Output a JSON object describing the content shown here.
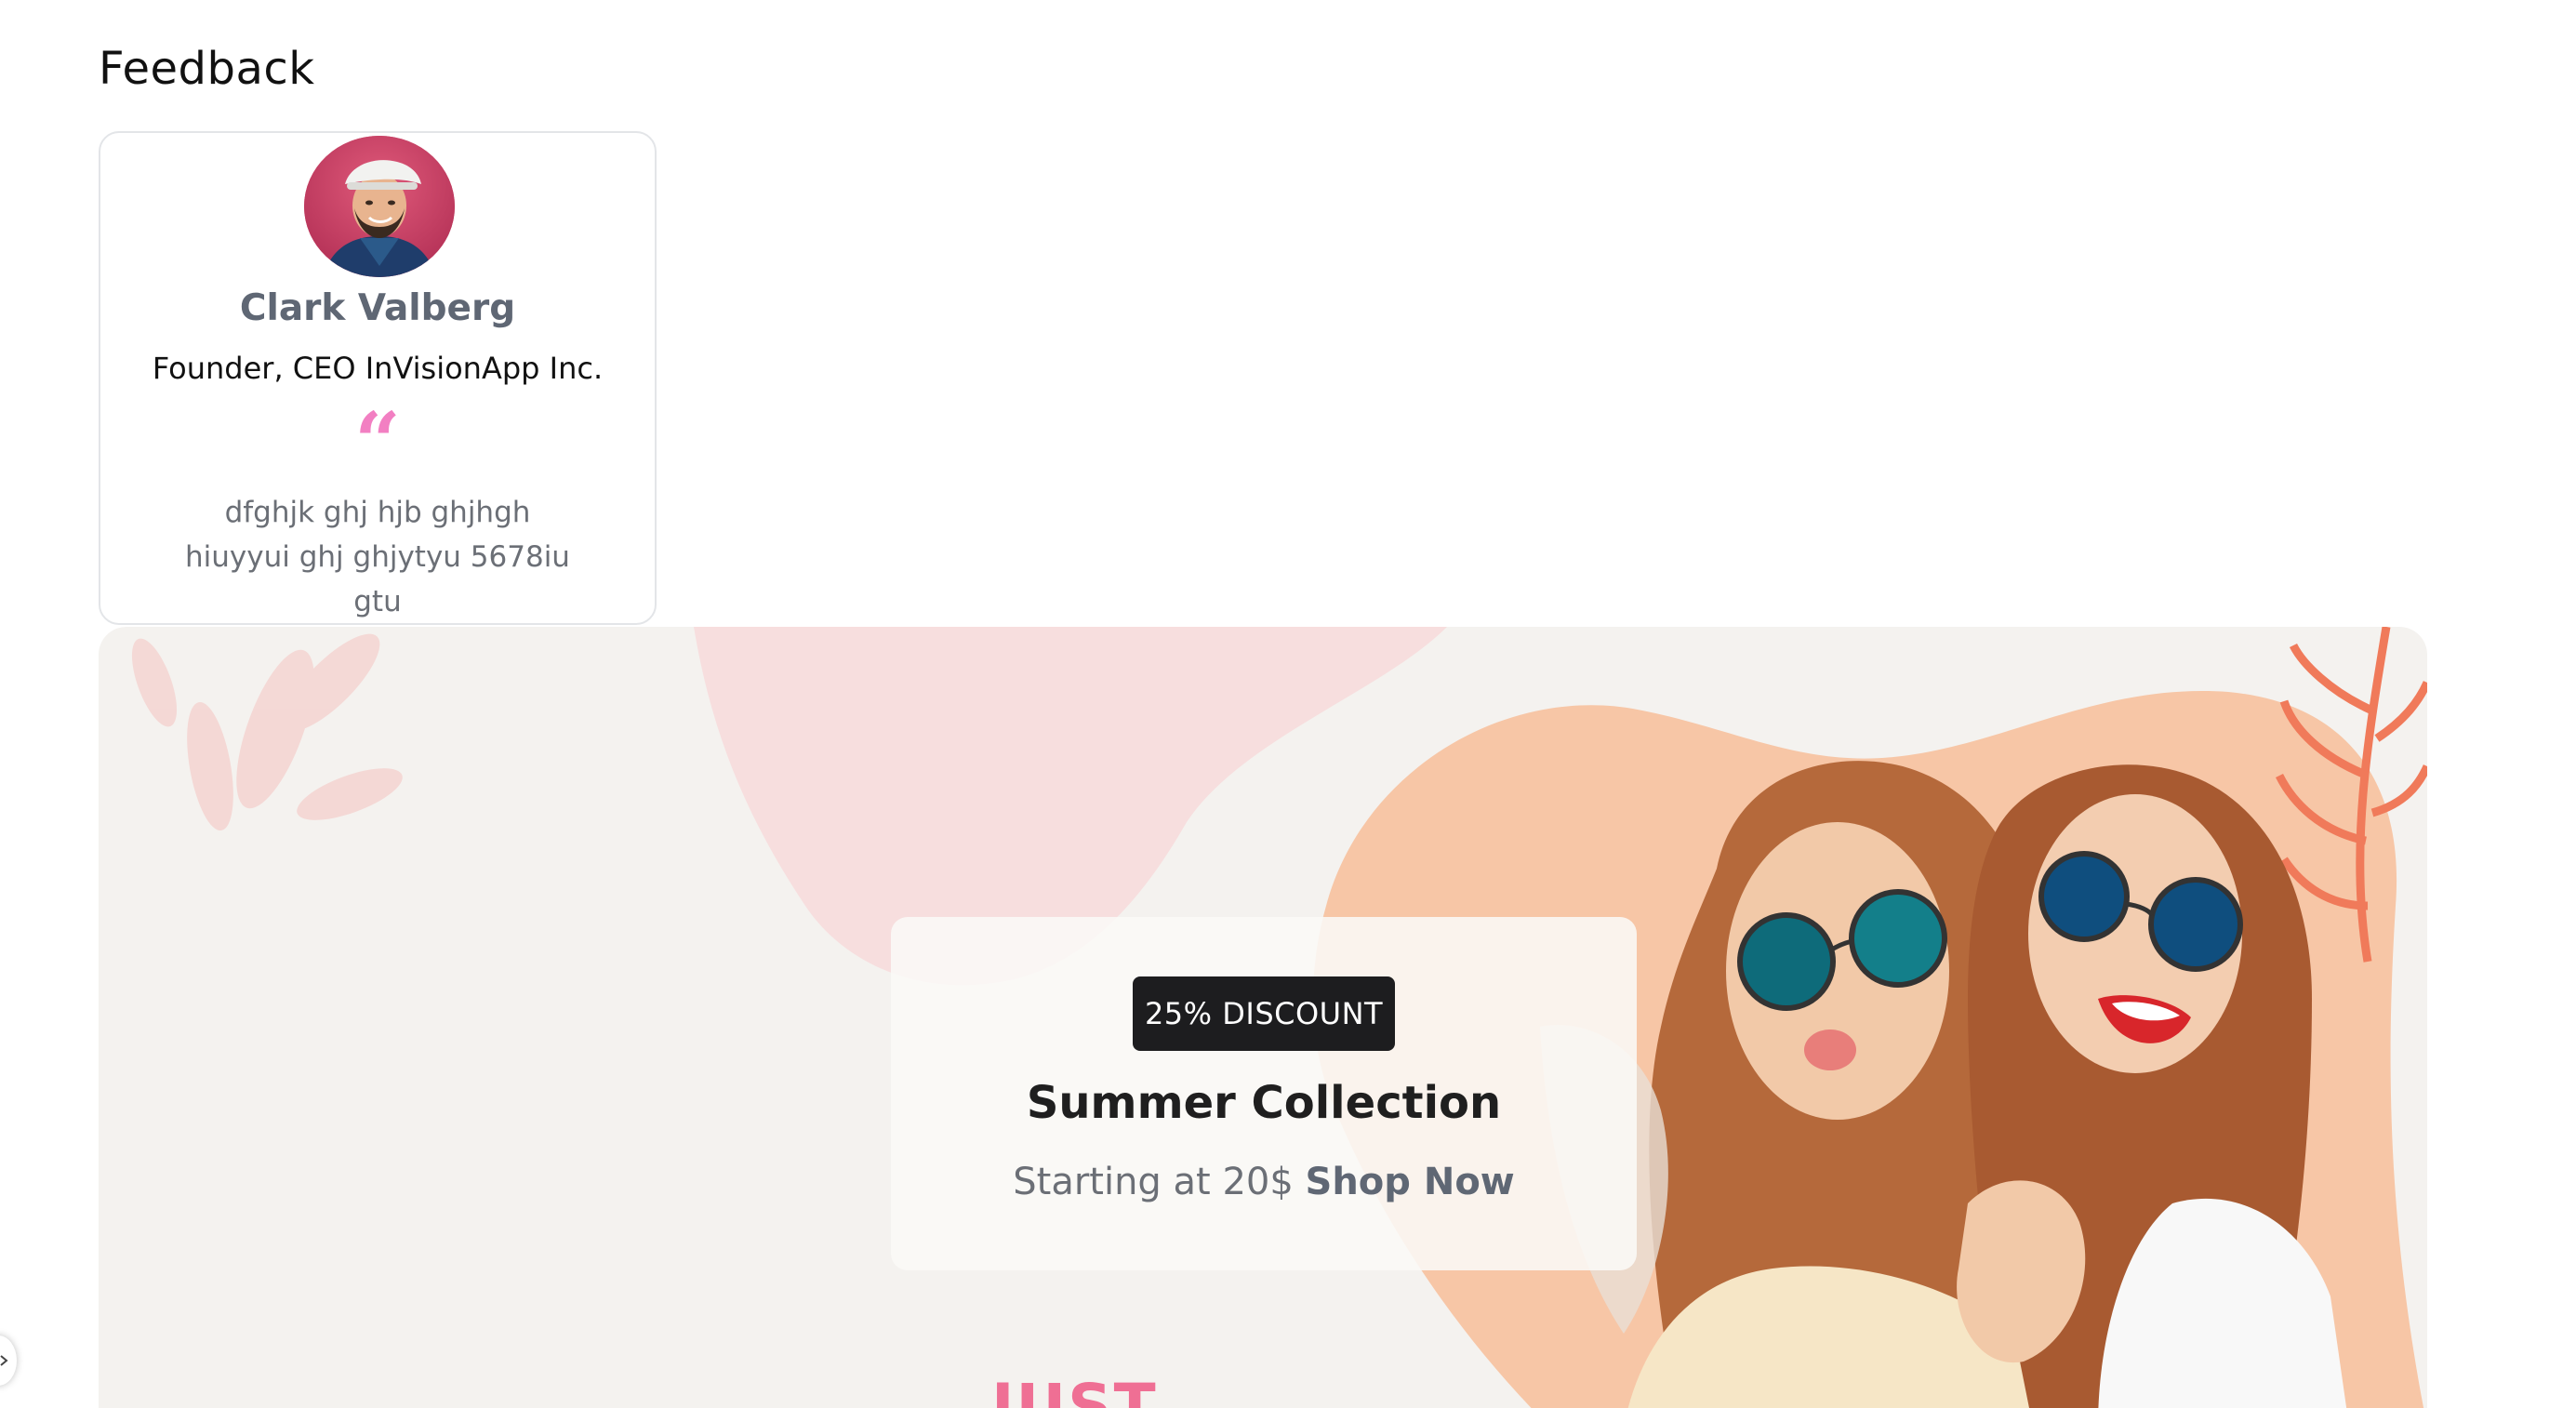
{
  "section": {
    "title": "Feedback"
  },
  "testimonial": {
    "name": "Clark Valberg",
    "role": "Founder, CEO InVisionApp Inc.",
    "quote_icon": "quote-icon",
    "quote_glyph": "“",
    "text_lines": [
      "dfghjk ghj hjb ghjhgh",
      "hiuyyui ghj ghjytyu 5678iu",
      "gtu"
    ]
  },
  "banner": {
    "discount_badge": "25% DISCOUNT",
    "title": "Summer Collection",
    "subtitle": "Starting at 20$",
    "cta": "Shop Now",
    "footer_text": "JUST"
  },
  "colors": {
    "accent_pink": "#f27fc2",
    "badge_bg": "#1d1d1f",
    "banner_bg": "#f4f2ef",
    "peach": "#f6c3a2"
  }
}
